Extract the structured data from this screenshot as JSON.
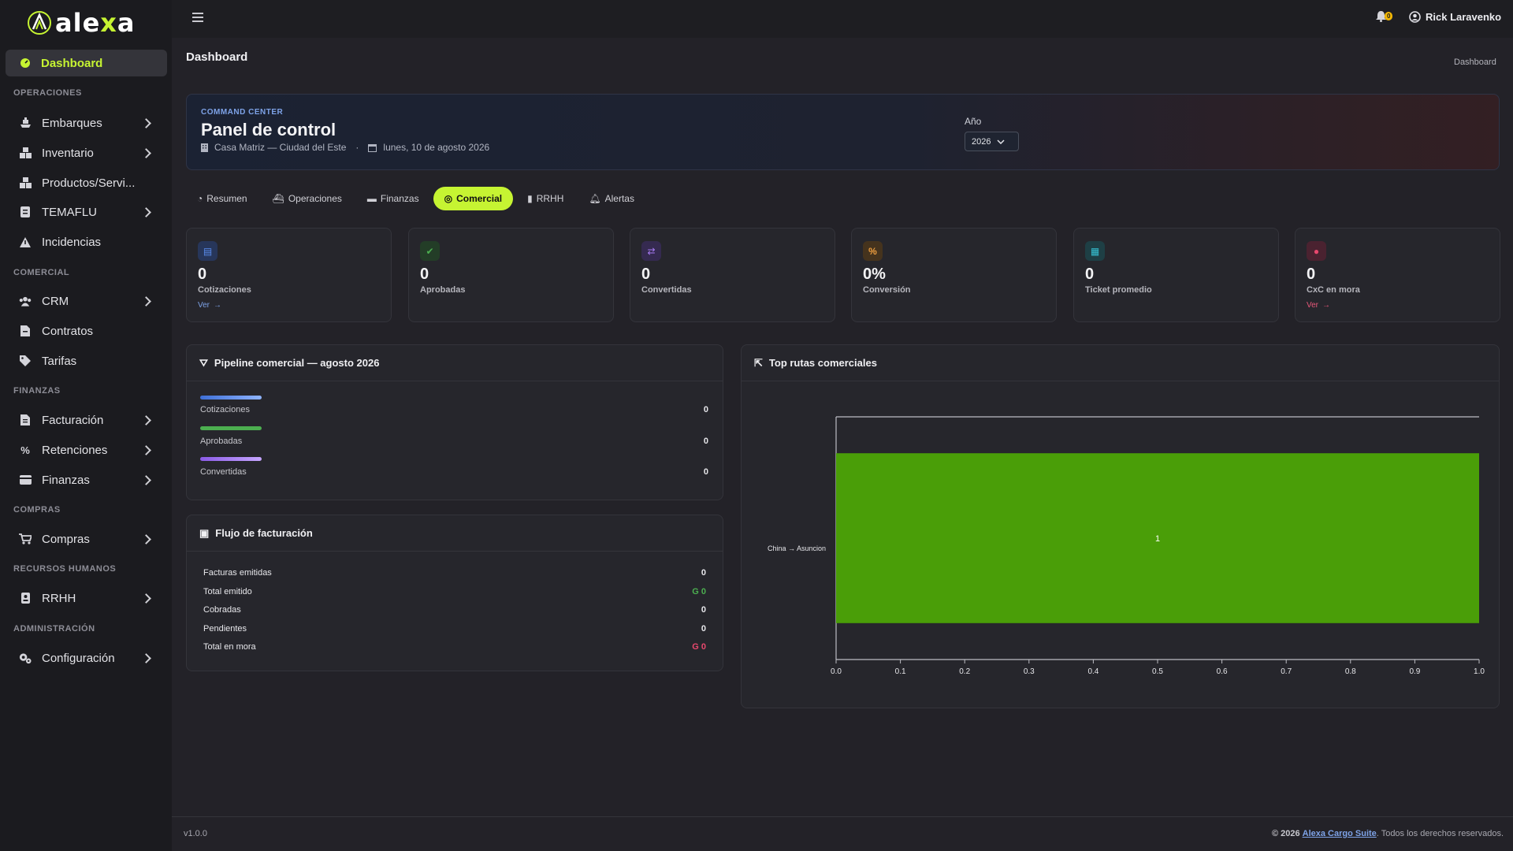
{
  "brand": {
    "logo_text_a": "ale",
    "logo_text_x": "x",
    "logo_text_b": "a",
    "accent": "#c6f432"
  },
  "sidebar": {
    "active": {
      "label": "Dashboard",
      "icon": "dashboard-icon"
    },
    "sections": [
      {
        "title": "OPERACIONES",
        "items": [
          {
            "label": "Embarques",
            "icon": "ship-icon",
            "has_children": true
          },
          {
            "label": "Inventario",
            "icon": "boxes-icon",
            "has_children": true
          },
          {
            "label": "Productos/Servi...",
            "icon": "boxes-icon",
            "has_children": false
          },
          {
            "label": "TEMAFLU",
            "icon": "document-icon",
            "has_children": true
          },
          {
            "label": "Incidencias",
            "icon": "warning-icon",
            "has_children": false
          }
        ]
      },
      {
        "title": "COMERCIAL",
        "items": [
          {
            "label": "CRM",
            "icon": "users-icon",
            "has_children": true
          },
          {
            "label": "Contratos",
            "icon": "contract-icon",
            "has_children": false
          },
          {
            "label": "Tarifas",
            "icon": "tags-icon",
            "has_children": false
          }
        ]
      },
      {
        "title": "FINANZAS",
        "items": [
          {
            "label": "Facturación",
            "icon": "invoice-icon",
            "has_children": true
          },
          {
            "label": "Retenciones",
            "icon": "percent-icon",
            "has_children": true
          },
          {
            "label": "Finanzas",
            "icon": "wallet-icon",
            "has_children": true
          }
        ]
      },
      {
        "title": "COMPRAS",
        "items": [
          {
            "label": "Compras",
            "icon": "cart-icon",
            "has_children": true
          }
        ]
      },
      {
        "title": "RECURSOS HUMANOS",
        "items": [
          {
            "label": "RRHH",
            "icon": "id-badge-icon",
            "has_children": true
          }
        ]
      },
      {
        "title": "ADMINISTRACIÓN",
        "items": [
          {
            "label": "Configuración",
            "icon": "gears-icon",
            "has_children": true
          }
        ]
      }
    ]
  },
  "topbar": {
    "notif_count": "0",
    "user_name": "Rick Laravenko"
  },
  "page": {
    "title": "Dashboard",
    "breadcrumb": "Dashboard"
  },
  "hero": {
    "eyebrow": "COMMAND CENTER",
    "title": "Panel de control",
    "location": "Casa Matriz — Ciudad del Este",
    "separator": "·",
    "date": "lunes, 10 de agosto 2026",
    "year_label": "Año",
    "year_value": "2026"
  },
  "tabs": [
    {
      "label": "Resumen",
      "icon": "gauge-icon",
      "active": false
    },
    {
      "label": "Operaciones",
      "icon": "ship-icon",
      "active": false
    },
    {
      "label": "Finanzas",
      "icon": "money-icon",
      "active": false
    },
    {
      "label": "Comercial",
      "icon": "target-icon",
      "active": true
    },
    {
      "label": "RRHH",
      "icon": "id-badge-icon",
      "active": false
    },
    {
      "label": "Alertas",
      "icon": "bell-icon",
      "active": false
    }
  ],
  "kpis": [
    {
      "value": "0",
      "label": "Cotizaciones",
      "icon": "file-icon",
      "color": "#5b8def",
      "link": "Ver"
    },
    {
      "value": "0",
      "label": "Aprobadas",
      "icon": "check-circle-icon",
      "color": "#4caf50",
      "link": ""
    },
    {
      "value": "0",
      "label": "Convertidas",
      "icon": "exchange-icon",
      "color": "#a77bf3",
      "link": ""
    },
    {
      "value": "0%",
      "label": "Conversión",
      "icon": "percent-icon",
      "color": "#f0a040",
      "link": ""
    },
    {
      "value": "0",
      "label": "Ticket promedio",
      "icon": "receipt-icon",
      "color": "#36c2d4",
      "link": ""
    },
    {
      "value": "0",
      "label": "CxC en mora",
      "icon": "alert-circle-icon",
      "color": "#e8486e",
      "link": "Ver"
    }
  ],
  "pipeline": {
    "title": "Pipeline comercial — agosto 2026",
    "rows": [
      {
        "label": "Cotizaciones",
        "value": "0",
        "color": "#5b8def"
      },
      {
        "label": "Aprobadas",
        "value": "0",
        "color": "#4caf50"
      },
      {
        "label": "Convertidas",
        "value": "0",
        "color": "#a77bf3"
      }
    ]
  },
  "billing": {
    "title": "Flujo de facturación",
    "rows": [
      {
        "label": "Facturas emitidas",
        "value": "0",
        "color": "#e8e8ec"
      },
      {
        "label": "Total emitido",
        "value": "G 0",
        "color": "#4caf50"
      },
      {
        "label": "Cobradas",
        "value": "0",
        "color": "#e8e8ec"
      },
      {
        "label": "Pendientes",
        "value": "0",
        "color": "#e8e8ec"
      },
      {
        "label": "Total en mora",
        "value": "G 0",
        "color": "#e8486e"
      }
    ]
  },
  "routes": {
    "title": "Top rutas comerciales"
  },
  "chart_data": {
    "type": "bar",
    "orientation": "horizontal",
    "categories": [
      "China → Asuncion"
    ],
    "values": [
      1
    ],
    "data_labels": [
      "1"
    ],
    "xlim": [
      0,
      1
    ],
    "xticks": [
      "0.0",
      "0.1",
      "0.2",
      "0.3",
      "0.4",
      "0.5",
      "0.6",
      "0.7",
      "0.8",
      "0.9",
      "1.0"
    ],
    "bar_color": "#4a9e08",
    "grid": false
  },
  "footer": {
    "version": "v1.0.0",
    "copyright_prefix": "© 2026",
    "company": "Alexa Cargo Suite",
    "rights": ". Todos los derechos reservados."
  }
}
